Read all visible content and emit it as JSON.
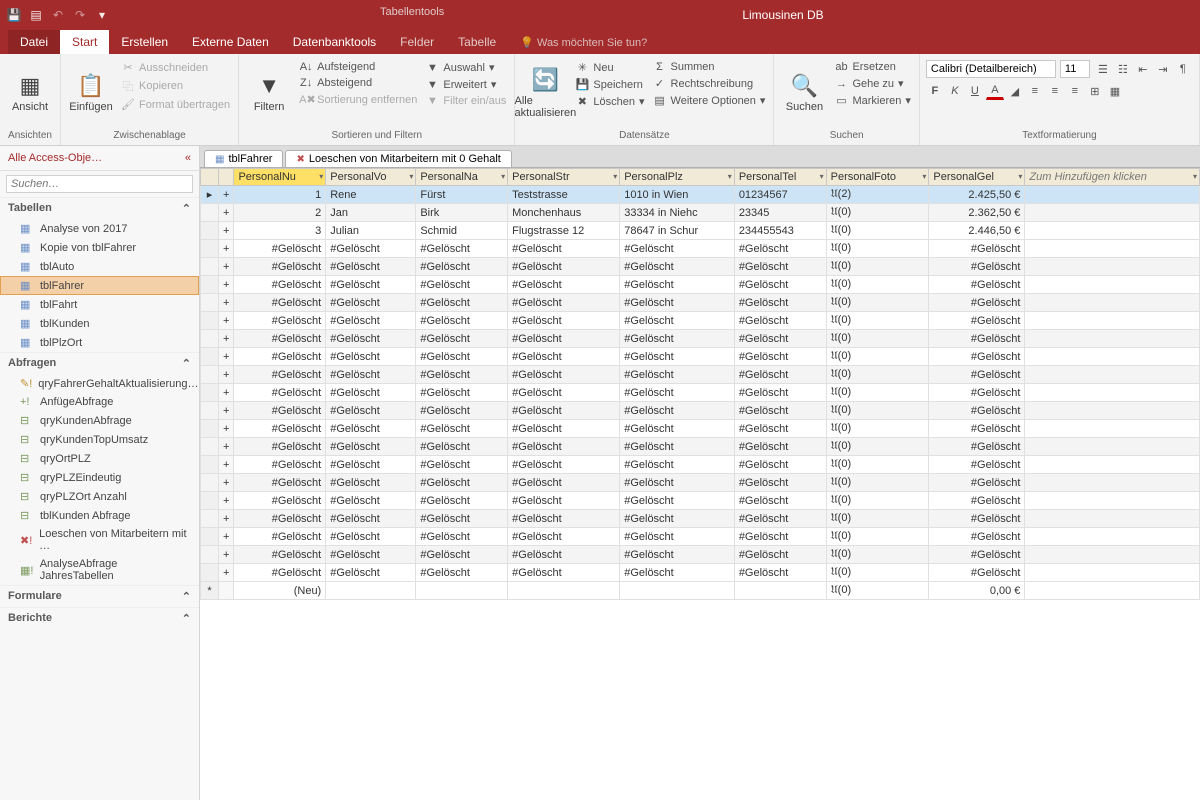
{
  "app": {
    "title": "Limousinen DB",
    "tabletools": "Tabellentools"
  },
  "qat": [
    "💾",
    "↶",
    "↷",
    "▾"
  ],
  "tabs": {
    "file": "Datei",
    "start": "Start",
    "erstellen": "Erstellen",
    "externe": "Externe Daten",
    "dbtools": "Datenbanktools",
    "felder": "Felder",
    "tabelle": "Tabelle",
    "tellme": "Was möchten Sie tun?"
  },
  "ribbon": {
    "ansicht": "Ansicht",
    "einfuegen": "Einfügen",
    "clipboard": {
      "label": "Zwischenablage",
      "cut": "Ausschneiden",
      "copy": "Kopieren",
      "format": "Format übertragen"
    },
    "sort": {
      "label": "Sortieren und Filtern",
      "filter": "Filtern",
      "asc": "Aufsteigend",
      "desc": "Absteigend",
      "clear": "Sortierung entfernen",
      "sel": "Auswahl",
      "adv": "Erweitert",
      "toggle": "Filter ein/aus"
    },
    "records": {
      "label": "Datensätze",
      "refresh": "Alle aktualisieren",
      "new": "Neu",
      "save": "Speichern",
      "delete": "Löschen",
      "sum": "Summen",
      "spell": "Rechtschreibung",
      "more": "Weitere Optionen"
    },
    "find": {
      "label": "Suchen",
      "find": "Suchen",
      "replace": "Ersetzen",
      "goto": "Gehe zu",
      "select": "Markieren"
    },
    "textfmt": {
      "label": "Textformatierung",
      "font": "Calibri (Detailbereich)",
      "size": "11"
    }
  },
  "nav": {
    "header": "Alle Access-Obje…",
    "search": "Suchen…",
    "groups": [
      {
        "name": "Tabellen",
        "items": [
          {
            "t": "tbl",
            "l": "Analyse von 2017"
          },
          {
            "t": "tbl",
            "l": "Kopie von tblFahrer"
          },
          {
            "t": "tbl",
            "l": "tblAuto"
          },
          {
            "t": "tbl",
            "l": "tblFahrer",
            "sel": true
          },
          {
            "t": "tbl",
            "l": "tblFahrt"
          },
          {
            "t": "tbl",
            "l": "tblKunden"
          },
          {
            "t": "tbl",
            "l": "tblPlzOrt"
          }
        ]
      },
      {
        "name": "Abfragen",
        "items": [
          {
            "t": "upd",
            "l": "qryFahrerGehaltAktualisierung…"
          },
          {
            "t": "app",
            "l": "AnfügeAbfrage"
          },
          {
            "t": "qry",
            "l": "qryKundenAbfrage"
          },
          {
            "t": "qry",
            "l": "qryKundenTopUmsatz"
          },
          {
            "t": "qry",
            "l": "qryOrtPLZ"
          },
          {
            "t": "qry",
            "l": "qryPLZEindeutig"
          },
          {
            "t": "qry",
            "l": "qryPLZOrt Anzahl"
          },
          {
            "t": "qry",
            "l": "tblKunden Abfrage"
          },
          {
            "t": "del",
            "l": "Loeschen von Mitarbeitern mit …"
          },
          {
            "t": "mk",
            "l": "AnalyseAbfrage JahresTabellen"
          }
        ]
      },
      {
        "name": "Formulare",
        "items": []
      },
      {
        "name": "Berichte",
        "items": []
      }
    ]
  },
  "doctabs": [
    {
      "ic": "▦",
      "l": "tblFahrer"
    },
    {
      "ic": "✖",
      "l": "Loeschen von Mitarbeitern mit 0 Gehalt"
    }
  ],
  "grid": {
    "columns": [
      "PersonalNu",
      "PersonalVo",
      "PersonalNa",
      "PersonalStr",
      "PersonalPlz",
      "PersonalTel",
      "PersonalFoto",
      "PersonalGel"
    ],
    "addcol": "Zum Hinzufügen klicken",
    "rows": [
      {
        "id": "1",
        "v": [
          "Rene",
          "Fürst",
          "Teststrasse",
          "1010 in Wien",
          "01234567",
          "𝔘(2)",
          "2.425,50 €"
        ],
        "sel": true
      },
      {
        "id": "2",
        "v": [
          "Jan",
          "Birk",
          "Monchenhaus",
          "33334 in Niehc",
          "23345",
          "𝔘(0)",
          "2.362,50 €"
        ]
      },
      {
        "id": "3",
        "v": [
          "Julian",
          "Schmid",
          "Flugstrasse 12",
          "78647 in Schur",
          "234455543",
          "𝔘(0)",
          "2.446,50 €"
        ]
      }
    ],
    "deleted": {
      "text": "#Gelöscht",
      "foto": "𝔘(0)",
      "count": 19
    },
    "newrow": {
      "id": "(Neu)",
      "foto": "𝔘(0)",
      "gel": "0,00 €"
    }
  }
}
